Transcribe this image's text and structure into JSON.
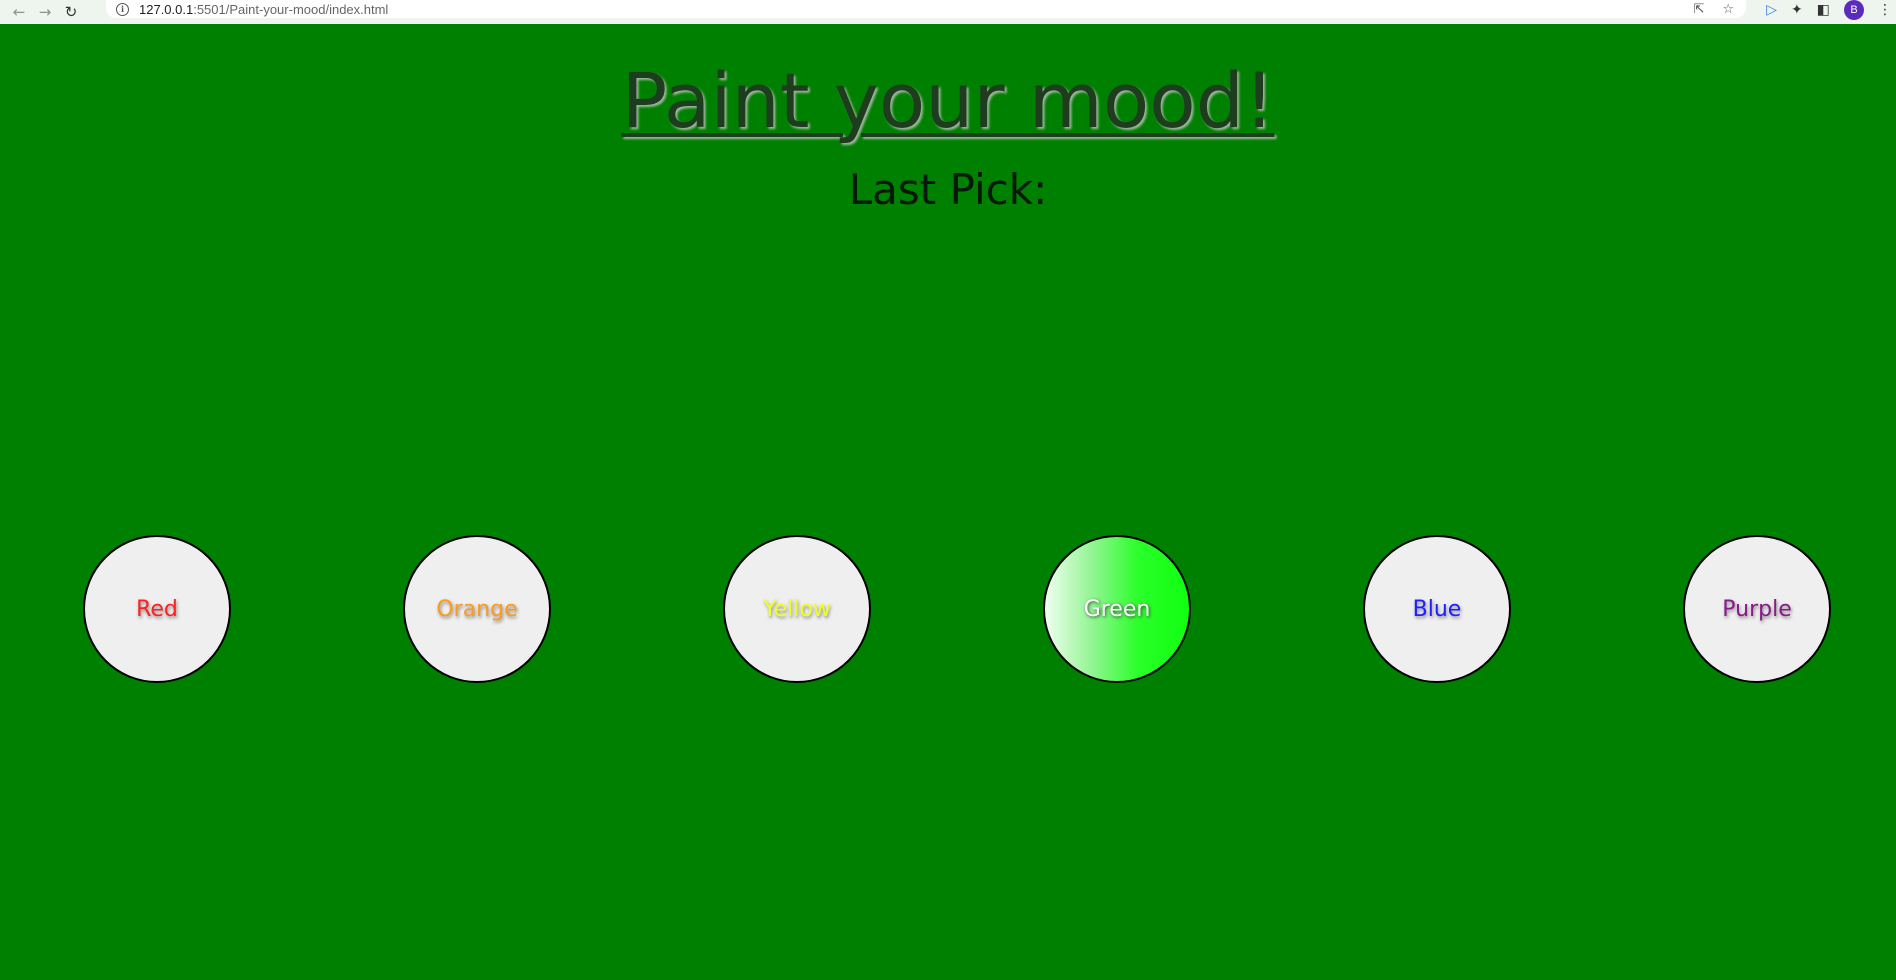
{
  "browser": {
    "url_host": "127.0.0.1",
    "url_path": ":5501/Paint-your-mood/index.html",
    "avatar_letter": "B"
  },
  "page": {
    "title": "Paint your mood!",
    "last_pick_label": "Last Pick:",
    "background_color": "#008000"
  },
  "colors": [
    {
      "label": "Red",
      "text_color": "#ff2020"
    },
    {
      "label": "Orange",
      "text_color": "#ff9a1a"
    },
    {
      "label": "Yellow",
      "text_color": "#f0ff20"
    },
    {
      "label": "Green",
      "text_color": "#ffffff",
      "active": true
    },
    {
      "label": "Blue",
      "text_color": "#2020ff"
    },
    {
      "label": "Purple",
      "text_color": "#8a1a8a"
    }
  ]
}
